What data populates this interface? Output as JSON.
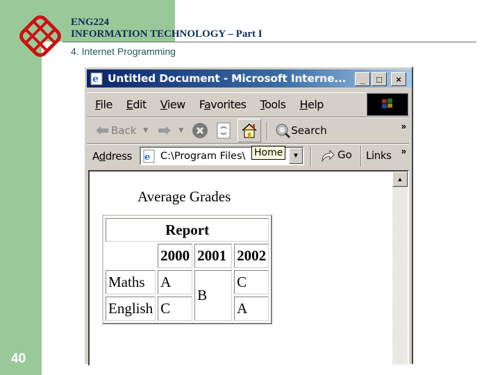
{
  "slide": {
    "course_code": "ENG224",
    "course_title": "INFORMATION TECHNOLOGY – Part I",
    "section": "4. Internet Programming",
    "page_number": "40",
    "accent_green": "#99c999",
    "logo_red": "#cc1111"
  },
  "browser": {
    "title": "Untitled Document - Microsoft Interne...",
    "window_buttons": {
      "minimize": "_",
      "maximize": "□",
      "close": "×"
    },
    "menu": [
      {
        "label": "File",
        "accel": "F",
        "rest": "ile"
      },
      {
        "label": "Edit",
        "accel": "E",
        "rest": "dit"
      },
      {
        "label": "View",
        "accel": "V",
        "rest": "iew"
      },
      {
        "label": "Favorites",
        "pre": "F",
        "accel": "a",
        "rest": "vorites"
      },
      {
        "label": "Tools",
        "accel": "T",
        "rest": "ools"
      },
      {
        "label": "Help",
        "accel": "H",
        "rest": "elp"
      }
    ],
    "toolbar": {
      "back_label": "Back",
      "search_label": "Search",
      "more": "»"
    },
    "address": {
      "label_pre": "A",
      "label_accel": "d",
      "label_rest": "dress",
      "value": "C:\\Program Files\\",
      "tooltip": "Home",
      "go_label": "Go",
      "links_label": "Links",
      "more": "»"
    }
  },
  "page": {
    "heading": "Average Grades",
    "table": {
      "caption": "Report",
      "years": [
        "2000",
        "2001",
        "2002"
      ],
      "rows": [
        {
          "subject": "Maths",
          "y2000": "A",
          "y2002": "C"
        },
        {
          "subject": "English",
          "y2000": "C",
          "y2002": "A"
        }
      ],
      "merged_2001": "B"
    }
  }
}
